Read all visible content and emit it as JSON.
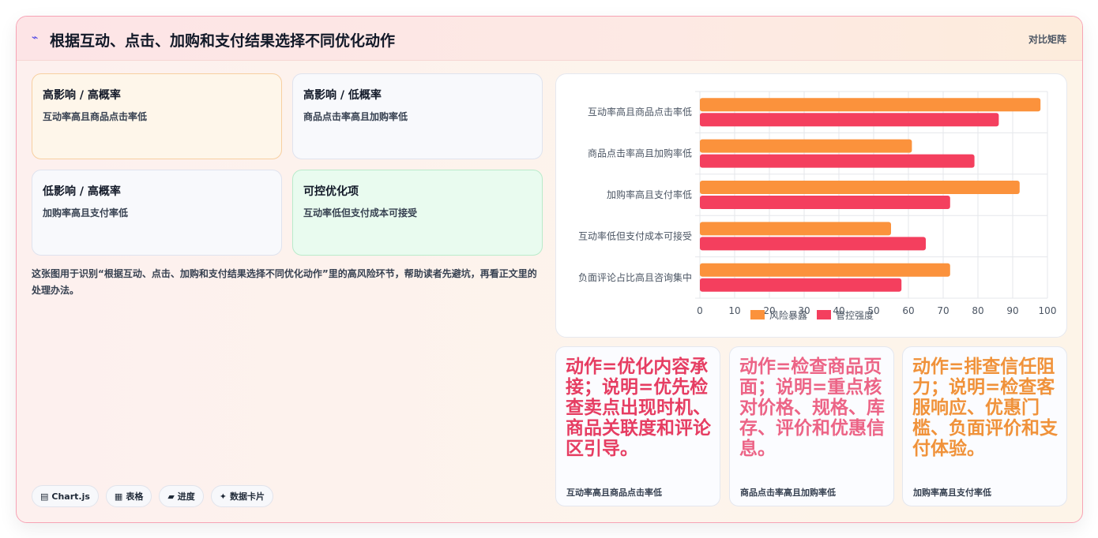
{
  "header": {
    "title": "根据互动、点击、加购和支付结果选择不同优化动作",
    "tag": "对比矩阵"
  },
  "quadrants": [
    {
      "title": "高影响 / 高概率",
      "desc": "互动率高且商品点击率低"
    },
    {
      "title": "高影响 / 低概率",
      "desc": "商品点击率高且加购率低"
    },
    {
      "title": "低影响 / 高概率",
      "desc": "加购率高且支付率低"
    },
    {
      "title": "可控优化项",
      "desc": "互动率低但支付成本可接受"
    }
  ],
  "description": "这张图用于识别“根据互动、点击、加购和支付结果选择不同优化动作”里的高风险环节，帮助读者先避坑，再看正文里的处理办法。",
  "chips": [
    {
      "icon": "▤",
      "icon_name": "chart-icon",
      "label": "Chart.js"
    },
    {
      "icon": "▦",
      "icon_name": "table-icon",
      "label": "表格"
    },
    {
      "icon": "▰",
      "icon_name": "progress-icon",
      "label": "进度"
    },
    {
      "icon": "✦",
      "icon_name": "sparkle-icon",
      "label": "数据卡片"
    }
  ],
  "actions": [
    {
      "text": "动作=优化内容承接；说明=优先检查卖点出现时机、商品关联度和评论区引导。",
      "sub": "互动率高且商品点击率低",
      "color": "#e63d62"
    },
    {
      "text": "动作=检查商品页面；说明=重点核对价格、规格、库存、评价和优惠信息。",
      "sub": "商品点击率高且加购率低",
      "color": "#ec6486"
    },
    {
      "text": "动作=排查信任阻力；说明=检查客服响应、优惠门槛、负面评价和支付体验。",
      "sub": "加购率高且支付率低",
      "color": "#f0923a"
    }
  ],
  "chart_data": {
    "type": "bar",
    "orientation": "horizontal",
    "categories": [
      "互动率高且商品点击率低",
      "商品点击率高且加购率低",
      "加购率高且支付率低",
      "互动率低但支付成本可接受",
      "负面评论占比高且咨询集中"
    ],
    "series": [
      {
        "name": "风险暴露",
        "values": [
          98,
          61,
          92,
          55,
          72
        ],
        "color": "#fb923c"
      },
      {
        "name": "管控强度",
        "values": [
          86,
          79,
          72,
          65,
          58
        ],
        "color": "#f43f5e"
      }
    ],
    "xlim": [
      0,
      100
    ],
    "xticks": [
      0,
      10,
      20,
      30,
      40,
      50,
      60,
      70,
      80,
      90,
      100
    ],
    "grid": true,
    "legend": "bottom"
  }
}
